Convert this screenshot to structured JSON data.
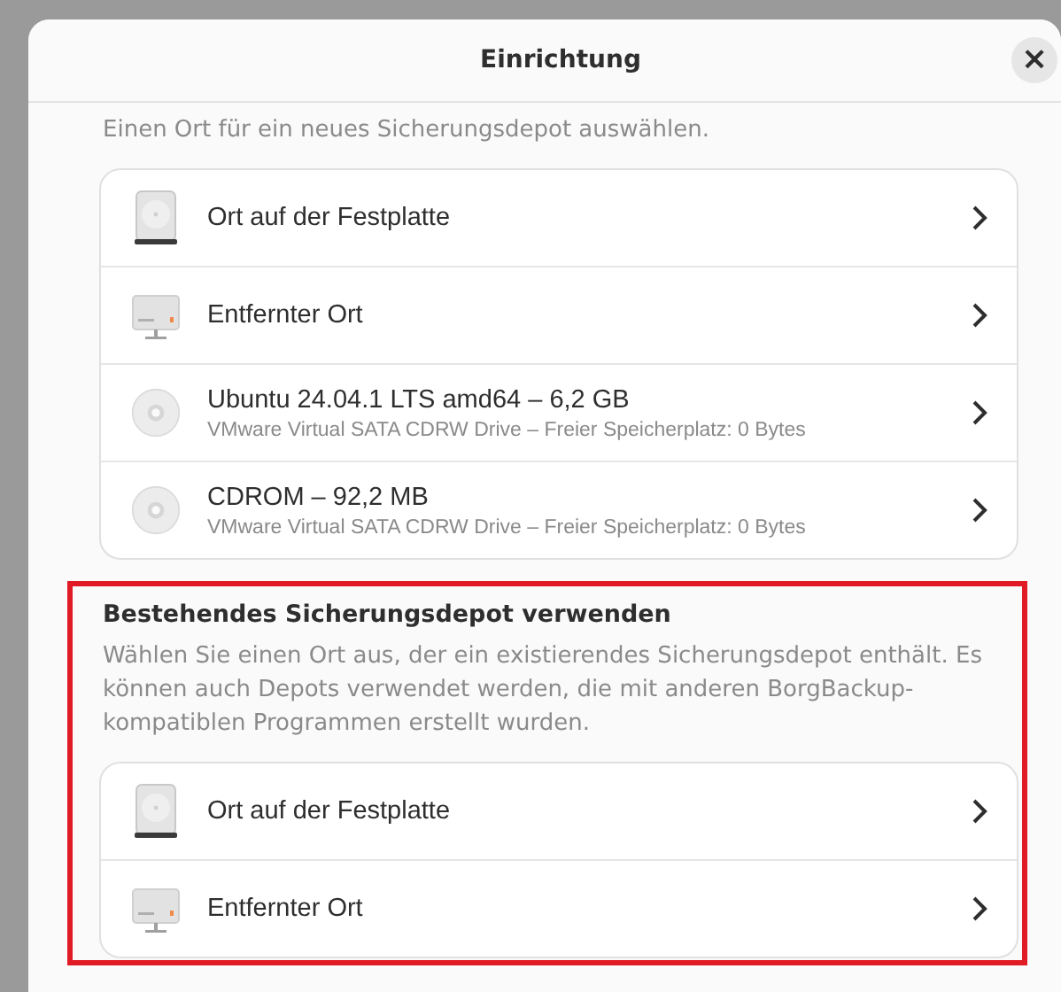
{
  "dialog": {
    "title": "Einrichtung",
    "close_button": "×"
  },
  "sections": [
    {
      "description": "Einen Ort für ein neues Sicherungsdepot auswählen.",
      "highlighted": false,
      "rows": [
        {
          "kind": "disk",
          "title": "Ort auf der Festplatte"
        },
        {
          "kind": "remote",
          "title": "Entfernter Ort"
        },
        {
          "kind": "optical",
          "title": "Ubuntu 24.04.1 LTS amd64 – 6,2 GB",
          "subtitle": "VMware Virtual SATA CDRW Drive – Freier Speicherplatz: 0 Bytes"
        },
        {
          "kind": "optical",
          "title": "CDROM – 92,2 MB",
          "subtitle": "VMware Virtual SATA CDRW Drive – Freier Speicherplatz: 0 Bytes"
        }
      ]
    },
    {
      "heading": "Bestehendes Sicherungsdepot verwenden",
      "description": "Wählen Sie einen Ort aus, der ein existierendes Sicherungsdepot enthält. Es können auch Depots verwendet werden, die mit anderen BorgBackup-kompatiblen Programmen erstellt wurden.",
      "highlighted": true,
      "rows": [
        {
          "kind": "disk",
          "title": "Ort auf der Festplatte"
        },
        {
          "kind": "remote",
          "title": "Entfernter Ort"
        }
      ]
    }
  ]
}
